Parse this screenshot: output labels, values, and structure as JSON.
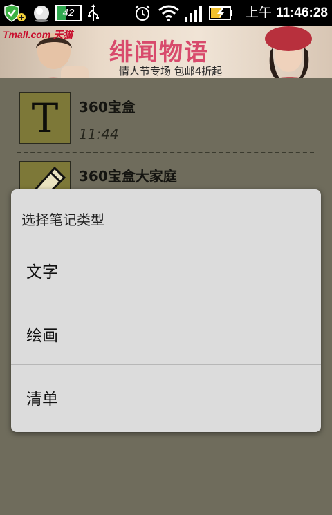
{
  "status_bar": {
    "battery_level": "42",
    "ampm": "上午",
    "time": "11:46:28",
    "icons": [
      "shield-plus-icon",
      "cloud-icon",
      "battery-icon",
      "usb-icon",
      "alarm-clock-icon",
      "wifi-icon",
      "signal-bars-icon",
      "charging-battery-icon"
    ]
  },
  "banner": {
    "logo": "Tmall.com 天猫",
    "headline": "绯闻物语",
    "subtitle": "情人节专场 包邮4折起"
  },
  "notes": [
    {
      "title": "360宝盒",
      "time": "11:44",
      "thumb_letter": "T",
      "thumb_icon": "text-note-icon"
    },
    {
      "title": "360宝盒大家庭",
      "thumb_icon": "pencil-icon"
    }
  ],
  "dialog": {
    "title": "选择笔记类型",
    "options": [
      {
        "label": "文字"
      },
      {
        "label": "绘画"
      },
      {
        "label": "清单"
      }
    ]
  }
}
